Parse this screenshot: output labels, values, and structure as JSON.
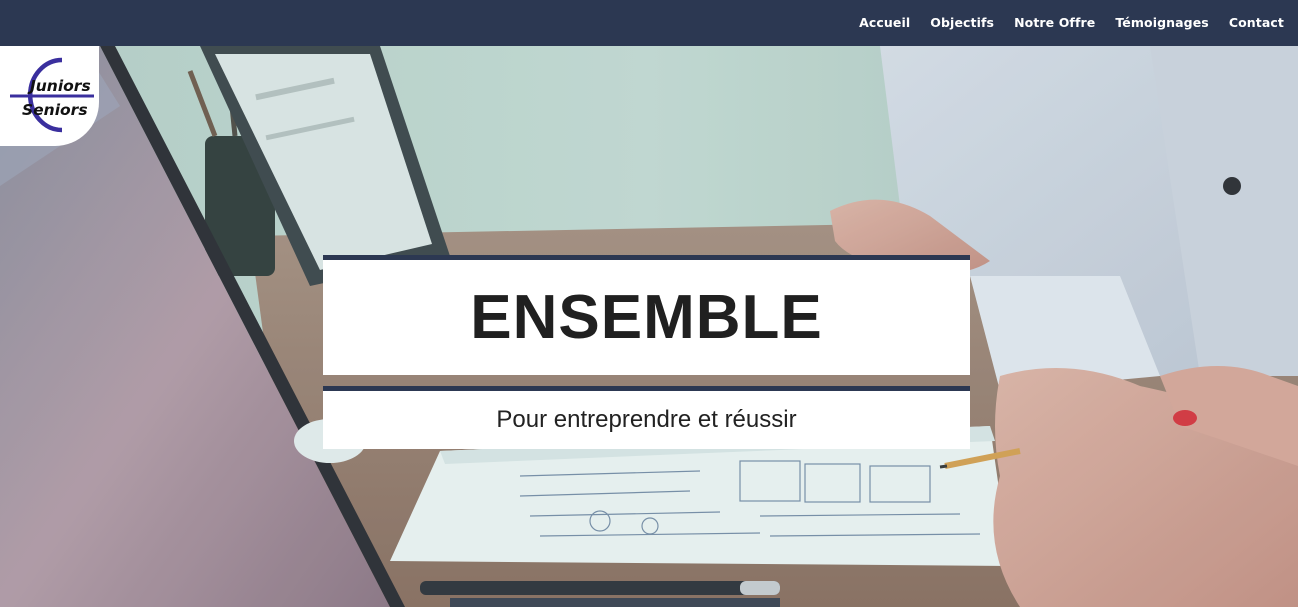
{
  "nav": {
    "items": [
      {
        "label": "Accueil"
      },
      {
        "label": "Objectifs"
      },
      {
        "label": "Notre Offre"
      },
      {
        "label": "Témoignages"
      },
      {
        "label": "Contact"
      }
    ]
  },
  "logo": {
    "line1": "Juniors",
    "line2": "Seniors"
  },
  "hero": {
    "title": "ENSEMBLE",
    "subtitle": "Pour entreprendre et réussir"
  },
  "colors": {
    "navbar": "#2c3852",
    "box_accent": "#2c3852",
    "logo_accent": "#3a2f9e"
  }
}
